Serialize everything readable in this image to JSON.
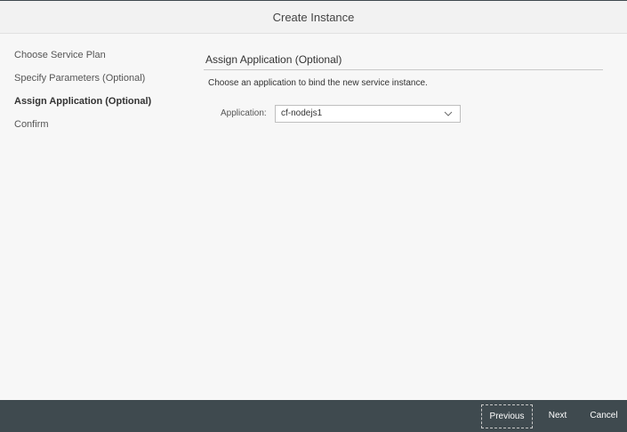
{
  "dialog": {
    "title": "Create Instance"
  },
  "steps": [
    {
      "label": "Choose Service Plan"
    },
    {
      "label": "Specify Parameters (Optional)"
    },
    {
      "label": "Assign Application (Optional)",
      "active": true
    },
    {
      "label": "Confirm"
    }
  ],
  "main": {
    "section_title": "Assign Application (Optional)",
    "description": "Choose an application to bind the new service instance.",
    "application_label": "Application:",
    "application_value": "cf-nodejs1",
    "dropdown_icon": "chevron-down-icon"
  },
  "footer": {
    "previous_label": "Previous",
    "next_label": "Next",
    "cancel_label": "Cancel"
  },
  "colors": {
    "footer_bg": "#3f4a4f",
    "header_bg": "#f2f2f2",
    "page_bg": "#f7f7f7"
  }
}
